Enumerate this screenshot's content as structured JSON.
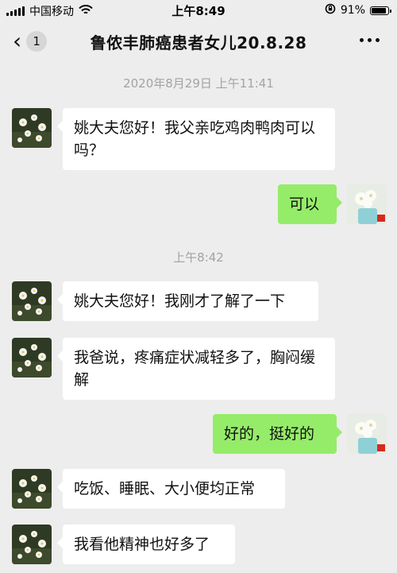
{
  "status_bar": {
    "carrier": "中国移动",
    "time": "上午8:49",
    "battery": "91%",
    "battery_level": 0.91
  },
  "nav": {
    "back_badge": "1",
    "title": "鲁侬丰肺癌患者女儿20.8.28"
  },
  "timestamps": {
    "first": "2020年8月29日 上午11:41",
    "second": "上午8:42"
  },
  "messages": [
    {
      "side": "in",
      "text": "姚大夫您好！我父亲吃鸡肉鸭肉可以吗？"
    },
    {
      "side": "out",
      "text": "可以"
    },
    {
      "side": "in",
      "text": "姚大夫您好！我刚才了解了一下"
    },
    {
      "side": "in",
      "text": "我爸说，疼痛症状减轻多了，胸闷缓解"
    },
    {
      "side": "out",
      "text": "好的，挺好的"
    },
    {
      "side": "in",
      "text": "吃饭、睡眠、大小便均正常"
    },
    {
      "side": "in",
      "text": "我看他精神也好多了"
    }
  ],
  "colors": {
    "background": "#ededed",
    "incoming_bubble": "#ffffff",
    "outgoing_bubble": "#95ec69",
    "timestamp": "#a3a3a3"
  },
  "icons": {
    "back": "chevron-left-icon",
    "more": "more-dots-icon",
    "wifi": "wifi-icon",
    "lock_rotation": "rotation-lock-icon",
    "battery": "battery-icon"
  }
}
